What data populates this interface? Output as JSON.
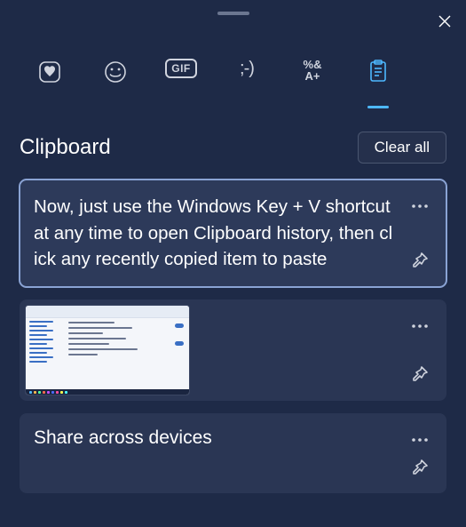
{
  "close_label": "Close",
  "tabs": {
    "recent": "Recent",
    "emoji": "Emoji",
    "gif": "GIF",
    "kaomoji": ";-)",
    "symbols_top": "%&",
    "symbols_bot": "A+",
    "clipboard": "Clipboard history"
  },
  "header": {
    "title": "Clipboard",
    "clear_all": "Clear all"
  },
  "items": [
    {
      "type": "text",
      "content": "Now, just use the Windows Key + V shortcut at any time to open Clipboard history, then click any recently copied item to paste"
    },
    {
      "type": "image",
      "alt": "Settings screenshot thumbnail"
    },
    {
      "type": "text",
      "content": "Share across devices"
    }
  ],
  "actions": {
    "more": "More options",
    "pin": "Pin"
  }
}
